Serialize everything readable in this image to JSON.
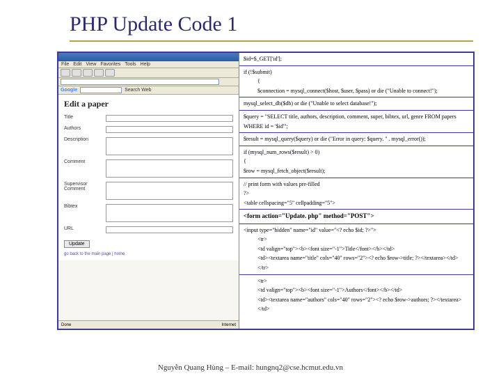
{
  "title": "PHP Update Code 1",
  "footer": "Nguyễn Quang Hùng – E-mail: hungnq2@cse.hcmut.edu.vn",
  "browser": {
    "menu": [
      "File",
      "Edit",
      "View",
      "Favorites",
      "Tools",
      "Help"
    ],
    "google": "Google",
    "search_label": "Search Web",
    "page_title": "Edit a paper",
    "labels": {
      "title": "Title",
      "authors": "Authors",
      "description": "Description",
      "comment": "Comment",
      "superv": "Supervisor Comment",
      "bibtex": "Bibtex",
      "url": "URL",
      "btn": "Update",
      "links": "go back to the main page | home"
    },
    "vals": {
      "title": "",
      "authors": "",
      "url": ""
    },
    "status": {
      "done": "Done",
      "right": "Internet"
    }
  },
  "code": {
    "c1": "$id=$_GET['id'];",
    "c2a": "if (!$submit)",
    "c2b": "{",
    "c2c": "$connection = mysql_connect($host, $user, $pass) or die (\"Unable to connect!\");",
    "c3": "mysql_select_db($db) or die (\"Unable to select database!\");",
    "c4": "$query = \"SELECT title, authors, description, comment, super, bibtex, url, genre FROM papers WHERE id = '$id'\";",
    "c5": "$result = mysql_query($query) or die (\"Error in query: $query. \" . mysql_error());",
    "c6a": "if (mysql_num_rows($result) > 0)",
    "c6b": "{",
    "c6c": "$row = mysql_fetch_object($result);",
    "c7a": "// print form with values pre-filled",
    "c7b": "?>",
    "c7c": "<table cellspacing=\"5\" cellpadding=\"5\">",
    "c8": "<form action=\"Update. php\"  method=\"POST\">",
    "c9a": "<input type=\"hidden\" name=\"id\" value=\"<? echo $id; ?>\">",
    "c9b": "<tr>",
    "c9c": "<td valign=\"top\"><b><font size=\"-1\">Title</font></b></td>",
    "c9d": "<td><textarea name=\"title\" cols=\"40\" rows=\"2\"><? echo $row->title; ?></textarea></td>",
    "c9e": "</tr>",
    "c10a": "<tr>",
    "c10b": "<td valign=\"top\"><b><font size=\"-1\">Authors</font></b></td>",
    "c10c": "<td><textarea name=\"authors\" cols=\"40\" rows=\"2\"><? echo $row->authors; ?></textarea></td>"
  }
}
